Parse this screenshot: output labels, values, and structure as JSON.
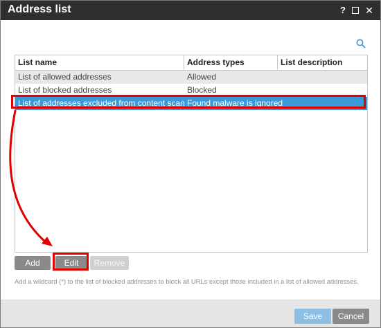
{
  "window": {
    "title": "Address list",
    "help_glyph": "?",
    "maximize_icon": "maximize-icon",
    "close_glyph": "✕"
  },
  "toolbar": {
    "search_icon": "search-icon"
  },
  "table": {
    "columns": [
      "List name",
      "Address types",
      "List description"
    ],
    "rows": [
      {
        "name": "List of allowed addresses",
        "type": "Allowed",
        "description": "",
        "selected": false
      },
      {
        "name": "List of blocked addresses",
        "type": "Blocked",
        "description": "",
        "selected": false
      },
      {
        "name": "List of addresses excluded from content scan",
        "type": "Found malware is ignored",
        "description": "",
        "selected": true
      }
    ]
  },
  "actions": {
    "add_label": "Add",
    "edit_label": "Edit",
    "remove_label": "Remove"
  },
  "hint": "Add a wildcard (*) to the list of blocked addresses to block all URLs except those included in a list of allowed addresses.",
  "footer": {
    "save_label": "Save",
    "cancel_label": "Cancel"
  },
  "colors": {
    "titlebar": "#2f2f2f",
    "selection": "#3a9ad9",
    "annotation": "#e00000",
    "primary_button": "#8cbfe3",
    "secondary_button": "#8a8a8a"
  }
}
